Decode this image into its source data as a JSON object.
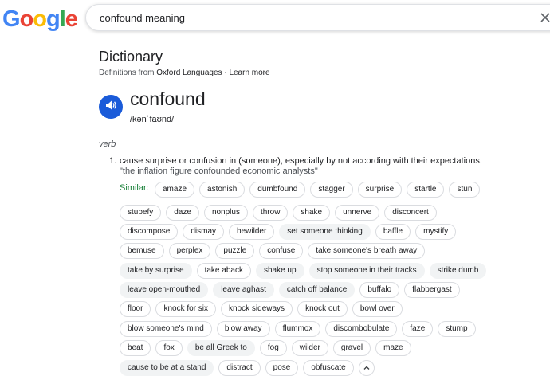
{
  "logo": {
    "letters": [
      "G",
      "o",
      "o",
      "g",
      "l",
      "e"
    ],
    "colors": [
      "#4285F4",
      "#EA4335",
      "#FBBC05",
      "#4285F4",
      "#34A853",
      "#EA4335"
    ]
  },
  "search": {
    "value": "confound meaning"
  },
  "icons": {
    "clear": "close-icon",
    "speaker": "speaker-icon",
    "collapse": "chevron-up-icon"
  },
  "dictionary": {
    "title": "Dictionary",
    "source_prefix": "Definitions from",
    "source_link": "Oxford Languages",
    "source_sep": "·",
    "learn_more": "Learn more",
    "headword": "confound",
    "phonetic": "/kənˈfaʊnd/",
    "pos": "verb",
    "definition_number": "1.",
    "definition": "cause surprise or confusion in (someone), especially by not according with their expectations.",
    "example": "\"the inflation figure confounded economic analysts\"",
    "similar_label": "Similar:",
    "accent_color": "#1a5bd9",
    "similar_color": "#188038"
  },
  "similar_rows": [
    [
      {
        "text": "amaze"
      },
      {
        "text": "astonish"
      },
      {
        "text": "dumbfound"
      },
      {
        "text": "stagger"
      },
      {
        "text": "surprise"
      },
      {
        "text": "startle"
      },
      {
        "text": "stun"
      }
    ],
    [
      {
        "text": "stupefy"
      },
      {
        "text": "daze"
      },
      {
        "text": "nonplus"
      },
      {
        "text": "throw"
      },
      {
        "text": "shake"
      },
      {
        "text": "unnerve"
      },
      {
        "text": "disconcert"
      }
    ],
    [
      {
        "text": "discompose"
      },
      {
        "text": "dismay"
      },
      {
        "text": "bewilder"
      },
      {
        "text": "set someone thinking",
        "filled": true
      },
      {
        "text": "baffle"
      },
      {
        "text": "mystify"
      }
    ],
    [
      {
        "text": "bemuse"
      },
      {
        "text": "perplex"
      },
      {
        "text": "puzzle"
      },
      {
        "text": "confuse"
      },
      {
        "text": "take someone's breath away"
      }
    ],
    [
      {
        "text": "take by surprise",
        "filled": true
      },
      {
        "text": "take aback"
      },
      {
        "text": "shake up",
        "filled": true
      },
      {
        "text": "stop someone in their tracks",
        "filled": true
      },
      {
        "text": "strike dumb",
        "filled": true
      }
    ],
    [
      {
        "text": "leave open-mouthed",
        "filled": true
      },
      {
        "text": "leave aghast",
        "filled": true
      },
      {
        "text": "catch off balance",
        "filled": true
      },
      {
        "text": "buffalo"
      },
      {
        "text": "flabbergast"
      }
    ],
    [
      {
        "text": "floor"
      },
      {
        "text": "knock for six"
      },
      {
        "text": "knock sideways"
      },
      {
        "text": "knock out"
      },
      {
        "text": "bowl over"
      }
    ],
    [
      {
        "text": "blow someone's mind"
      },
      {
        "text": "blow away"
      },
      {
        "text": "flummox"
      },
      {
        "text": "discombobulate"
      },
      {
        "text": "faze"
      },
      {
        "text": "stump"
      }
    ],
    [
      {
        "text": "beat"
      },
      {
        "text": "fox"
      },
      {
        "text": "be all Greek to",
        "filled": true
      },
      {
        "text": "fog"
      },
      {
        "text": "wilder"
      },
      {
        "text": "gravel"
      },
      {
        "text": "maze"
      }
    ],
    [
      {
        "text": "cause to be at a stand",
        "filled": true
      },
      {
        "text": "distract"
      },
      {
        "text": "pose"
      },
      {
        "text": "obfuscate"
      }
    ]
  ]
}
